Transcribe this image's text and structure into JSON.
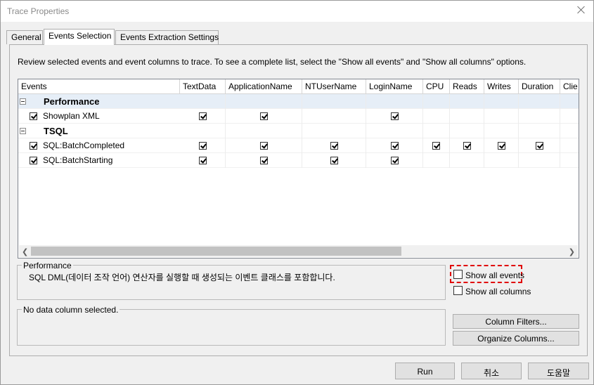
{
  "window": {
    "title": "Trace Properties"
  },
  "tabs": [
    {
      "label": "General"
    },
    {
      "label": "Events Selection"
    },
    {
      "label": "Events Extraction Settings"
    }
  ],
  "description": "Review selected events and event columns to trace. To see a complete list, select the \"Show all events\" and \"Show all columns\" options.",
  "grid": {
    "columns": [
      "Events",
      "TextData",
      "ApplicationName",
      "NTUserName",
      "LoginName",
      "CPU",
      "Reads",
      "Writes",
      "Duration",
      "Clie"
    ],
    "categories": [
      {
        "name": "Performance",
        "events": [
          {
            "name": "Showplan XML",
            "checked": true,
            "cols": [
              true,
              true,
              false,
              true,
              false,
              false,
              false,
              false,
              false
            ]
          }
        ]
      },
      {
        "name": "TSQL",
        "events": [
          {
            "name": "SQL:BatchCompleted",
            "checked": true,
            "cols": [
              true,
              true,
              true,
              true,
              true,
              true,
              true,
              true,
              false
            ]
          },
          {
            "name": "SQL:BatchStarting",
            "checked": true,
            "cols": [
              true,
              true,
              true,
              true,
              false,
              false,
              false,
              false,
              false
            ]
          }
        ]
      }
    ]
  },
  "event_info": {
    "legend": "Performance",
    "text": "SQL DML(데이터 조작 언어) 연산자를 실행할 때 생성되는 이벤트 클래스를 포함합니다."
  },
  "column_info": {
    "legend": "No data column selected."
  },
  "options": {
    "show_all_events": {
      "label": "Show all events",
      "checked": false
    },
    "show_all_columns": {
      "label": "Show all columns",
      "checked": false
    }
  },
  "buttons": {
    "column_filters": "Column Filters...",
    "organize_columns": "Organize Columns...",
    "run": "Run",
    "cancel": "취소",
    "help": "도움말"
  }
}
